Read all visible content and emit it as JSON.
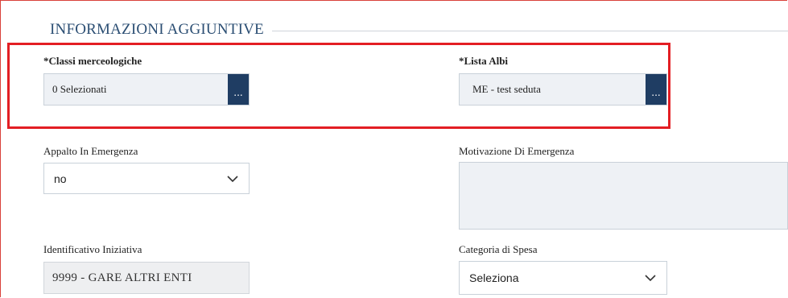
{
  "section": {
    "title": "INFORMAZIONI AGGIUNTIVE"
  },
  "classi": {
    "label": "*Classi merceologiche",
    "value": "0 Selezionati",
    "button": "..."
  },
  "albi": {
    "label": "*Lista Albi",
    "value": "ME - test seduta",
    "button": "..."
  },
  "emergenza": {
    "label": "Appalto In Emergenza",
    "value": "no"
  },
  "motivazione": {
    "label": "Motivazione Di Emergenza",
    "value": ""
  },
  "identificativo": {
    "label": "Identificativo Iniziativa",
    "value": "9999 - GARE ALTRI ENTI"
  },
  "categoria": {
    "label": "Categoria di Spesa",
    "value": "Seleziona"
  },
  "colors": {
    "highlight": "#e31e24",
    "button_bg": "#1f3d63",
    "section_title": "#2b4e73"
  }
}
